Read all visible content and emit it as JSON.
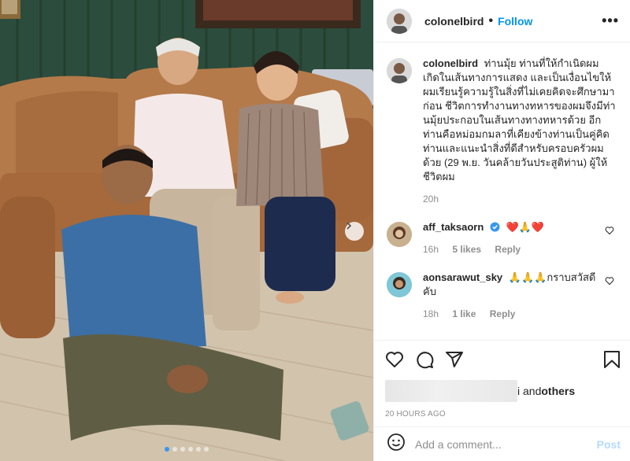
{
  "post": {
    "username": "colonelbird",
    "follow_label": "Follow",
    "separator": "•",
    "more_label": "•••",
    "caption_user": "colonelbird",
    "caption_text": "ท่านมุ้ย ท่านที่ให้กำเนิดผม เกิดในเส้นทางการแสดง และเป็นเงื่อนไขให้ผมเรียนรู้ความรู้ในสิ่งที่ไม่เคยคิดจะศึกษามาก่อน ชีวิตการทำงานทางทหารของผมจึงมีท่านมุ้ยประกอบในเส้นทางทางทหารด้วย อีกท่านคือหม่อมกมลาที่เคียงข้างท่านเป็นคู่คิดท่านและแนะนำสิ่งที่ดีสำหรับครอบครัวผมด้วย (29 พ.ย. วันคล้ายวันประสูติท่าน) ผู้ให้ชีวิตผม",
    "caption_time": "20h"
  },
  "comments": [
    {
      "user": "aff_taksaorn",
      "verified": true,
      "text": "❤️🙏❤️",
      "time": "16h",
      "likes": "5 likes",
      "reply": "Reply"
    },
    {
      "user": "aonsarawut_sky",
      "verified": false,
      "text": "🙏🙏🙏กราบสวัสดีคับ",
      "time": "18h",
      "likes": "1 like",
      "reply": "Reply"
    }
  ],
  "likes": {
    "text_prefix": "i and ",
    "others": "others"
  },
  "timestamp": "20 HOURS AGO",
  "add_comment": {
    "placeholder": "Add a comment...",
    "post_label": "Post"
  },
  "carousel": {
    "total": 6,
    "active_index": 0
  },
  "icons": [
    "heart-icon",
    "comment-icon",
    "share-icon",
    "save-icon",
    "emoji-icon",
    "next-arrow-icon",
    "verified-icon"
  ],
  "colors": {
    "follow": "#0095f6",
    "verified": "#3897f0",
    "post_disabled": "#b3dbff",
    "heart": "#ed4956",
    "active_dot": "#3897f0"
  }
}
